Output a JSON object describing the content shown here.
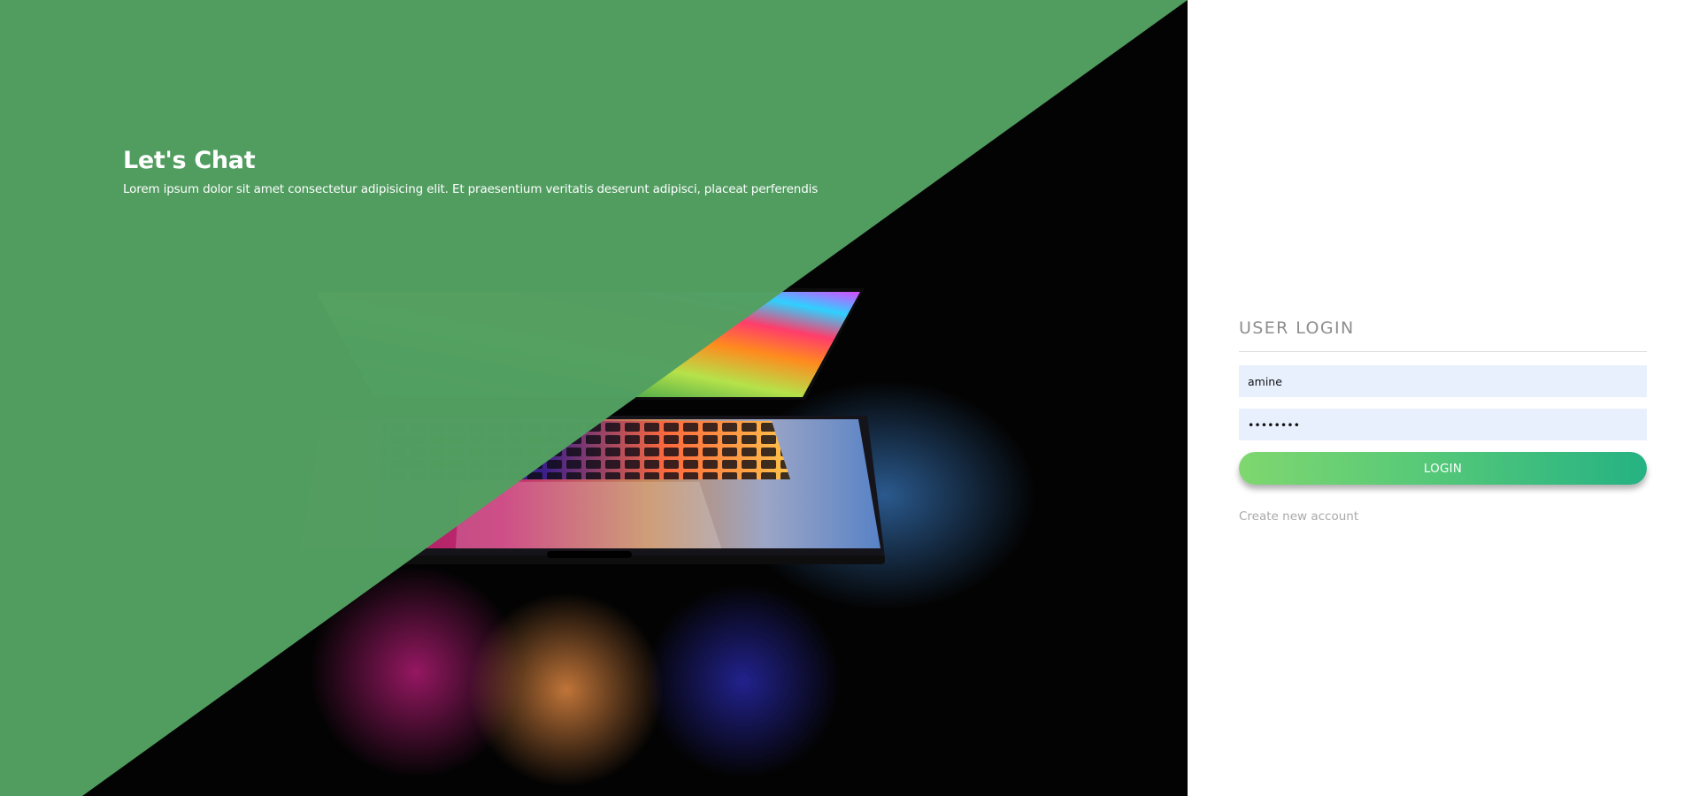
{
  "hero": {
    "title": "Let's Chat",
    "subtitle": "Lorem ipsum dolor sit amet consectetur adipisicing elit. Et praesentium veritatis deserunt adipisci, placeat perferendis",
    "overlay_color": "#52a062"
  },
  "login": {
    "heading": "USER LOGIN",
    "username_value": "amine",
    "password_value": "••••••••",
    "button_label": "LOGIN",
    "create_account_label": "Create new account"
  },
  "colors": {
    "accent_start": "#7fd76f",
    "accent_end": "#25b283",
    "field_background": "#e8f0fe",
    "muted_text": "#8e8e8e"
  }
}
